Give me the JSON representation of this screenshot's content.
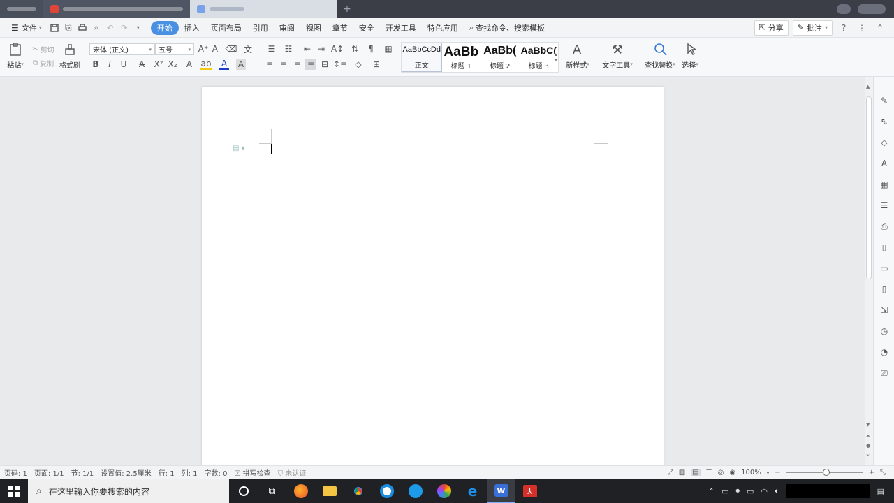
{
  "menu": {
    "file": "文件",
    "tabs": [
      "开始",
      "插入",
      "页面布局",
      "引用",
      "审阅",
      "视图",
      "章节",
      "安全",
      "开发工具",
      "特色应用"
    ],
    "search_placeholder": "查找命令、搜索模板",
    "share": "分享",
    "comment": "批注"
  },
  "ribbon": {
    "paste": "粘贴",
    "cut": "剪切",
    "copy": "复制",
    "format_painter": "格式刷",
    "font_name": "宋体 (正文)",
    "font_size": "五号",
    "styles": [
      {
        "preview": "AaBbCcDd",
        "name": "正文"
      },
      {
        "preview": "AaBb",
        "name": "标题 1"
      },
      {
        "preview": "AaBb(",
        "name": "标题 2"
      },
      {
        "preview": "AaBbC(",
        "name": "标题 3"
      }
    ],
    "new_style": "新样式",
    "text_tools": "文字工具",
    "find_replace": "查找替换",
    "select": "选择"
  },
  "status": {
    "page_no": "页码: 1",
    "pages": "页面: 1/1",
    "section": "节: 1/1",
    "setting": "设置值: 2.5厘米",
    "row": "行: 1",
    "col": "列: 1",
    "words": "字数: 0",
    "spell": "拼写检查",
    "cert": "未认证",
    "zoom": "100%"
  },
  "taskbar": {
    "search_placeholder": "在这里输入你要搜索的内容"
  },
  "colors": {
    "accent": "#4a90e2",
    "titlebar": "#3b3e47",
    "taskbar": "#1f2125"
  }
}
